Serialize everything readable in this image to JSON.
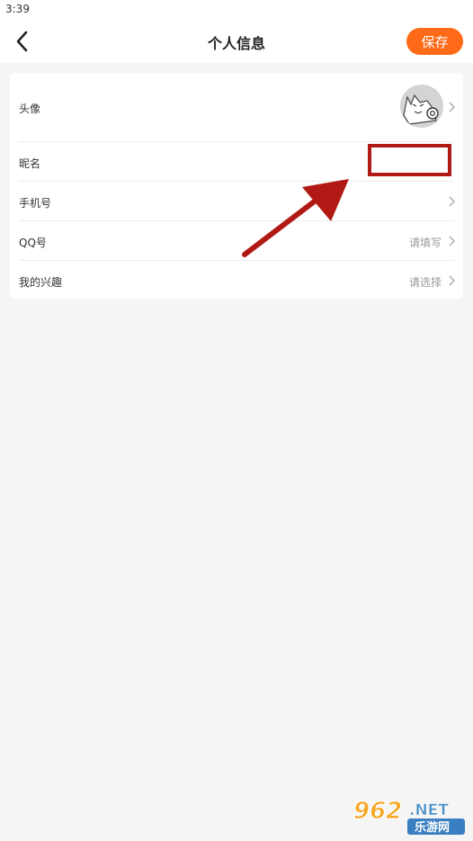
{
  "status_bar": {
    "time": "3:39"
  },
  "header": {
    "title": "个人信息",
    "save_label": "保存"
  },
  "rows": [
    {
      "label": "头像",
      "value": ""
    },
    {
      "label": "昵名",
      "value": ""
    },
    {
      "label": "手机号",
      "value": ""
    },
    {
      "label": "QQ号",
      "value": "请填写"
    },
    {
      "label": "我的兴趣",
      "value": "请选择"
    }
  ],
  "watermark": {
    "number": "962",
    "suffix": ".NET",
    "subtitle": "乐游网"
  },
  "colors": {
    "accent": "#ff6a18",
    "annotation": "#b01914",
    "background": "#f5f5f5"
  },
  "icons": [
    "back-arrow-icon",
    "chevron-right-icon",
    "avatar-image"
  ]
}
